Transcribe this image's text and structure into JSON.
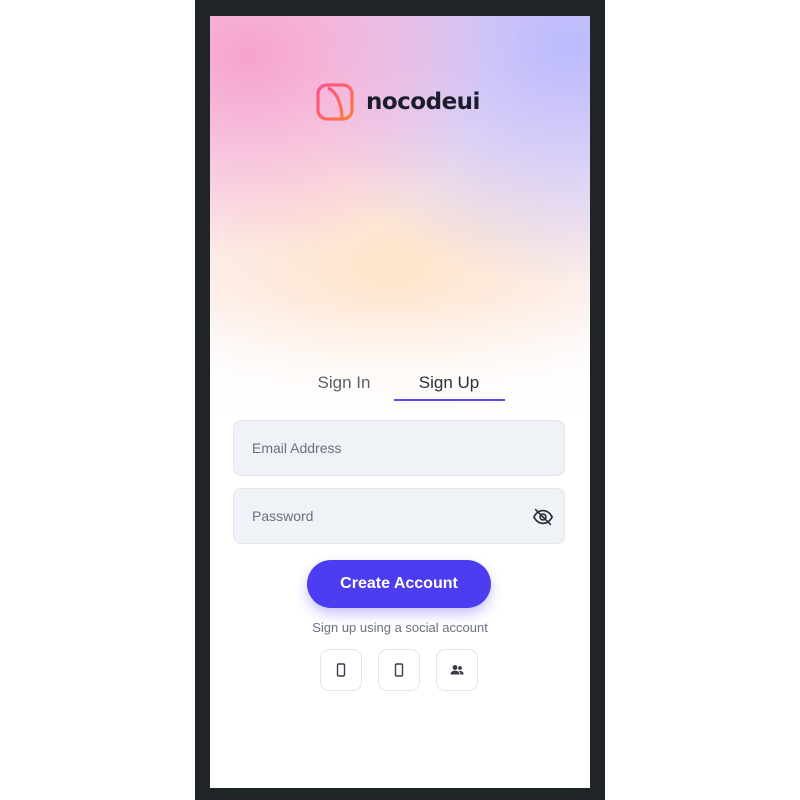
{
  "brand": {
    "name": "nocodeui",
    "accent_color": "#4d3df0",
    "logo_gradient": [
      "#ff5b8a",
      "#ff7a3d"
    ]
  },
  "tabs": [
    {
      "label": "Sign In",
      "active": false
    },
    {
      "label": "Sign Up",
      "active": true
    }
  ],
  "form": {
    "email": {
      "placeholder": "Email Address",
      "value": ""
    },
    "password": {
      "placeholder": "Password",
      "value": ""
    },
    "password_toggle_icon": "eye-slash-icon",
    "submit_label": "Create Account"
  },
  "social": {
    "caption": "Sign up using a social account",
    "buttons": [
      {
        "icon": "mobile-icon"
      },
      {
        "icon": "mobile-icon"
      },
      {
        "icon": "users-icon"
      }
    ]
  }
}
